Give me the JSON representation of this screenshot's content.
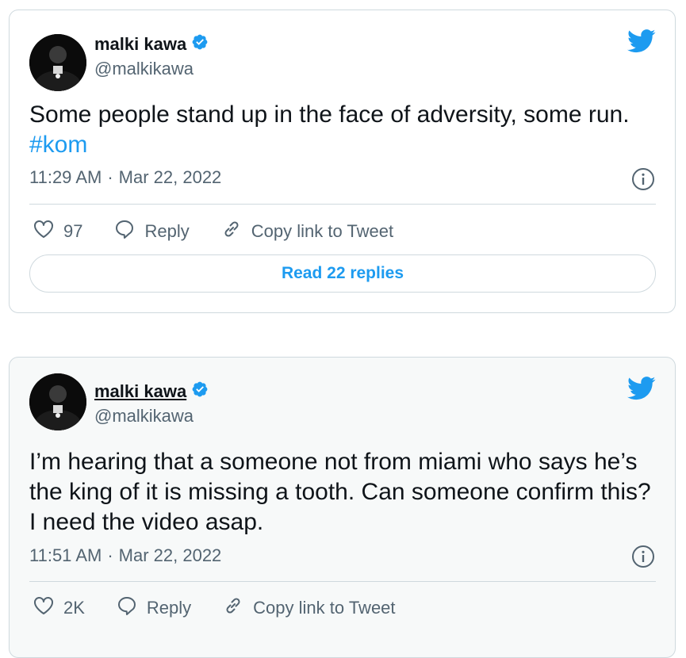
{
  "colors": {
    "accent": "#1d9bf0",
    "text_primary": "#0f1419",
    "text_secondary": "#536471",
    "border": "#cfd9de"
  },
  "tweets": [
    {
      "display_name": "malki kawa",
      "handle": "@malkikawa",
      "verified": true,
      "text": "Some people stand up in the face of adversity, some run.",
      "hashtag": "#kom",
      "time": "11:29 AM",
      "date": "Mar 22, 2022",
      "likes": "97",
      "reply_label": "Reply",
      "copy_label": "Copy link to Tweet",
      "read_replies_label": "Read 22 replies"
    },
    {
      "display_name": "malki kawa",
      "handle": "@malkikawa",
      "verified": true,
      "text": "I’m hearing that a someone not from miami who says he’s the king of it is missing a tooth. Can someone confirm this? I need the video asap.",
      "time": "11:51 AM",
      "date": "Mar 22, 2022",
      "likes": "2K",
      "reply_label": "Reply",
      "copy_label": "Copy link to Tweet"
    }
  ],
  "separator": "·",
  "icons": [
    "avatar",
    "verified-badge-icon",
    "twitter-bird-icon",
    "info-icon",
    "heart-icon",
    "reply-icon",
    "link-icon"
  ]
}
